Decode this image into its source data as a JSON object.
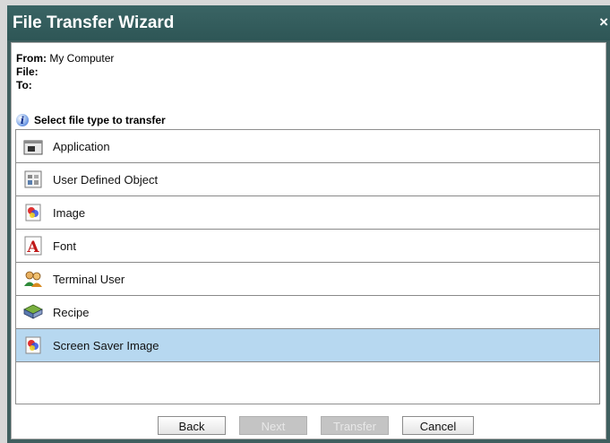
{
  "window": {
    "title": "File Transfer Wizard",
    "close_glyph": "×"
  },
  "info": {
    "from_label": "From:",
    "from_value": "My Computer",
    "file_label": "File:",
    "file_value": "",
    "to_label": "To:",
    "to_value": ""
  },
  "select_header": "Select file type to transfer",
  "file_types": [
    {
      "label": "Application",
      "icon": "application-icon",
      "selected": false
    },
    {
      "label": "User Defined Object",
      "icon": "user-defined-object-icon",
      "selected": false
    },
    {
      "label": "Image",
      "icon": "image-icon",
      "selected": false
    },
    {
      "label": "Font",
      "icon": "font-icon",
      "selected": false
    },
    {
      "label": "Terminal User",
      "icon": "terminal-user-icon",
      "selected": false
    },
    {
      "label": "Recipe",
      "icon": "recipe-icon",
      "selected": false
    },
    {
      "label": "Screen Saver Image",
      "icon": "screen-saver-image-icon",
      "selected": true
    }
  ],
  "buttons": {
    "back": "Back",
    "next": "Next",
    "transfer": "Transfer",
    "cancel": "Cancel"
  },
  "colors": {
    "titlebar": "#2e5656",
    "selected_row": "#b7d8f0"
  }
}
